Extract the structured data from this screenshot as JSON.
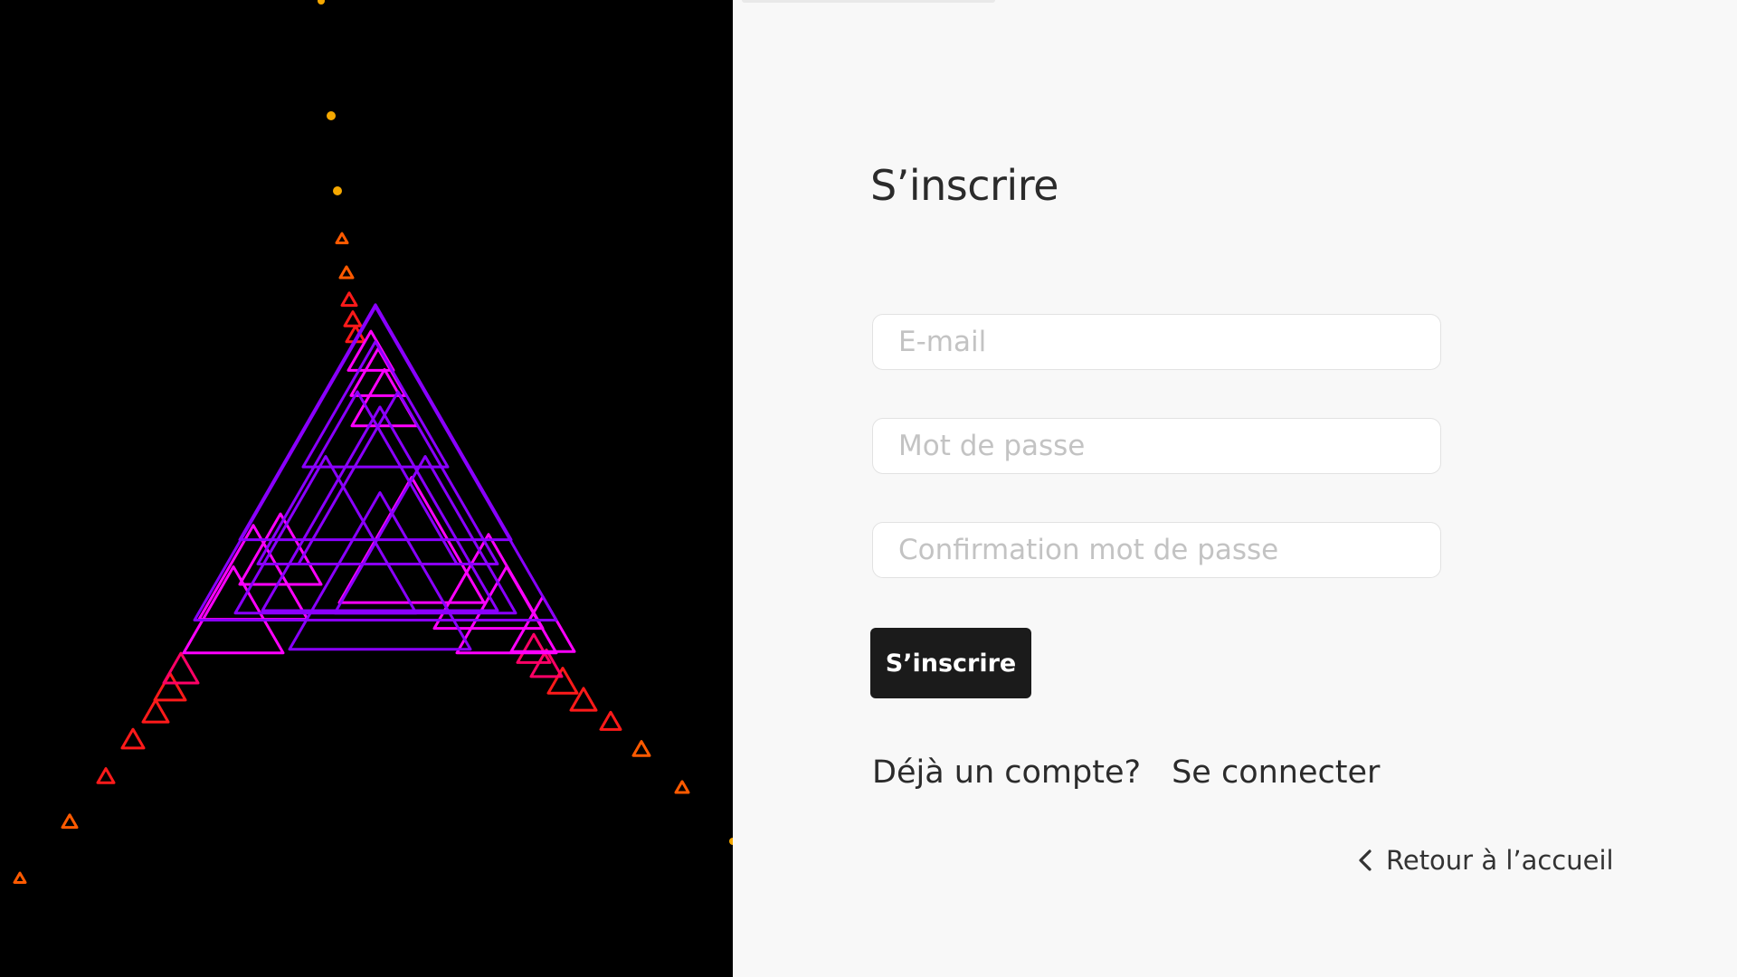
{
  "auth": {
    "title": "S’inscrire",
    "email_placeholder": "E-mail",
    "password_placeholder": "Mot de passe",
    "confirm_placeholder": "Confirmation mot de passe",
    "submit_label": "S’inscrire",
    "has_account_text": "Déjà un compte?",
    "login_link": "Se connecter",
    "back_label": "Retour à l’accueil"
  },
  "icons": {
    "back": "chevron-left-icon"
  },
  "colors": {
    "art_background": "#000000",
    "page_background": "#f8f8f8",
    "button_background": "#1b1b1b",
    "art_gold": "#f5a800",
    "art_orange": "#ff5a00",
    "art_red": "#ff1a1a",
    "art_magenta": "#ff00ff",
    "art_violet": "#8a00ff"
  }
}
